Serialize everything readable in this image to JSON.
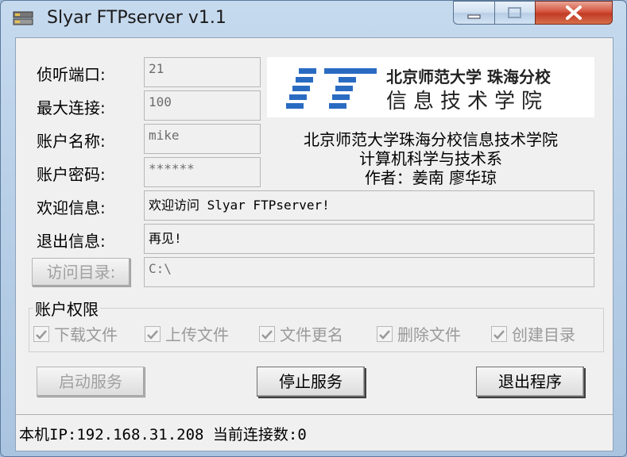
{
  "window": {
    "title": "Slyar FTPserver v1.1"
  },
  "form": {
    "port_label": "侦听端口:",
    "port_value": "21",
    "maxconn_label": "最大连接:",
    "maxconn_value": "100",
    "user_label": "账户名称:",
    "user_value": "mike",
    "pass_label": "账户密码:",
    "pass_value": "******",
    "welcome_label": "欢迎信息:",
    "welcome_value": "欢迎访问 Slyar FTPserver!",
    "exit_label": "退出信息:",
    "exit_value": "再见!",
    "dir_button": "访问目录:",
    "dir_value": "C:\\"
  },
  "logo": {
    "big": "IT",
    "line1": "北京师范大学 珠海分校",
    "line2": "信息技术学院",
    "accent": "#2a6bc2"
  },
  "info": {
    "line1": "北京师范大学珠海分校信息技术学院",
    "line2": "计算机科学与技术系",
    "line3": "作者：姜南  廖华琼"
  },
  "permissions": {
    "title": "账户权限",
    "items": [
      "下载文件",
      "上传文件",
      "文件更名",
      "删除文件",
      "创建目录"
    ]
  },
  "buttons": {
    "start": "启动服务",
    "stop": "停止服务",
    "exit": "退出程序"
  },
  "status": {
    "text": "本机IP:192.168.31.208 当前连接数:0"
  }
}
